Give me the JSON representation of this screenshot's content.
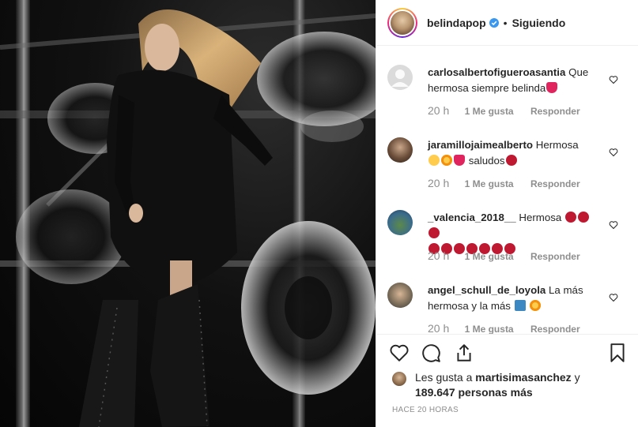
{
  "header": {
    "username": "belindapop",
    "separator": "•",
    "follow_status": "Siguiendo"
  },
  "comments": [
    {
      "username": "carlosalbertofigueroasantia",
      "text": "Que hermosa siempre belinda",
      "emojis": [
        "red-heart"
      ],
      "time": "20 h",
      "likes": "1 Me gusta",
      "reply": "Responder",
      "avatar": "default-avatar"
    },
    {
      "username": "jaramillojaimealberto",
      "text": "Hermosa",
      "text_after": "saludos",
      "emojis": [
        "winking-face-kiss",
        "star-struck",
        "red-heart",
        "rose"
      ],
      "time": "20 h",
      "likes": "1 Me gusta",
      "reply": "Responder"
    },
    {
      "username": "_valencia_2018__",
      "text": "Hermosa",
      "emojis": [
        "rose",
        "rose",
        "rose",
        "rose",
        "rose",
        "rose",
        "rose",
        "rose",
        "rose",
        "rose"
      ],
      "time": "20 h",
      "likes": "1 Me gusta",
      "reply": "Responder"
    },
    {
      "username": "angel_schull_de_loyola",
      "text": "La más hermosa y la más",
      "emojis": [
        "top-arrow",
        "star-struck"
      ],
      "time": "20 h",
      "likes": "1 Me gusta",
      "reply": "Responder"
    }
  ],
  "likes": {
    "prefix": "Les gusta a",
    "user": "martisimasanchez",
    "conj": "y",
    "count_text": "189.647 personas más"
  },
  "time_ago": "HACE 20 HORAS",
  "icons": [
    "heart-icon",
    "comment-icon",
    "share-icon",
    "bookmark-icon",
    "verified-badge-icon"
  ],
  "colors": {
    "verified": "#3897f0",
    "heart": "#ed4956",
    "muted": "#8e8e8e"
  }
}
